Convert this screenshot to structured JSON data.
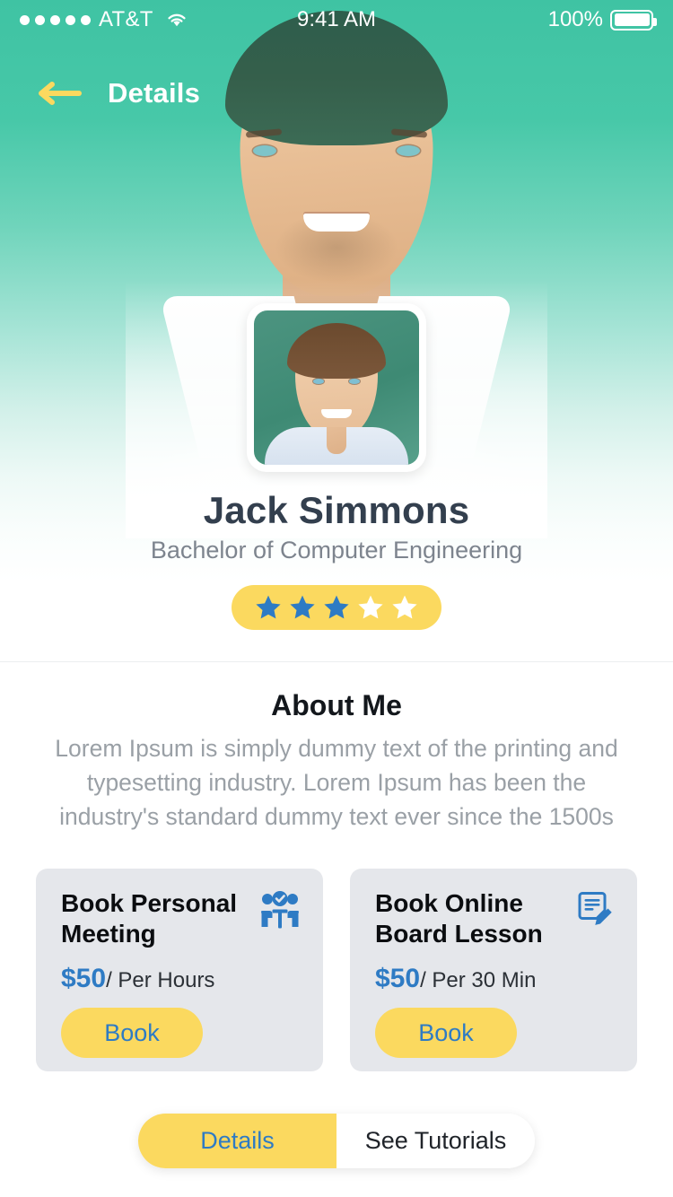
{
  "status_bar": {
    "signal_dots": 5,
    "carrier": "AT&T",
    "wifi_icon": "wifi-icon",
    "time": "9:41 AM",
    "battery_percent": "100%",
    "battery_icon": "battery-full-icon"
  },
  "nav": {
    "back_icon": "back-arrow-icon",
    "title": "Details"
  },
  "profile": {
    "avatar_name": "profile-avatar",
    "name": "Jack Simmons",
    "subtitle": "Bachelor of Computer Engineering",
    "rating": {
      "filled": 3,
      "total": 5,
      "filled_color": "#2E7BC4",
      "empty_color": "#FFFFFF",
      "pill_color": "#FBD95F"
    }
  },
  "about": {
    "title": "About Me",
    "body": "Lorem Ipsum is simply dummy text of the printing and typesetting industry. Lorem Ipsum has been the industry's standard dummy text ever since the 1500s"
  },
  "cards": [
    {
      "title": "Book Personal Meeting",
      "icon": "group-meeting-icon",
      "price": "$50",
      "price_unit": "/ Per Hours",
      "button_label": "Book"
    },
    {
      "title": "Book Online Board Lesson",
      "icon": "document-edit-icon",
      "price": "$50",
      "price_unit": "/ Per 30 Min",
      "button_label": "Book"
    }
  ],
  "tabs": [
    {
      "label": "Details",
      "active": true
    },
    {
      "label": "See Tutorials",
      "active": false
    }
  ],
  "theme": {
    "hero_top": "#3FC3A3",
    "accent_yellow": "#FBD95F",
    "accent_blue": "#2E7BC4",
    "card_bg": "#E5E7EB",
    "name_color": "#333F4E",
    "muted_text": "#9AA0A6"
  }
}
